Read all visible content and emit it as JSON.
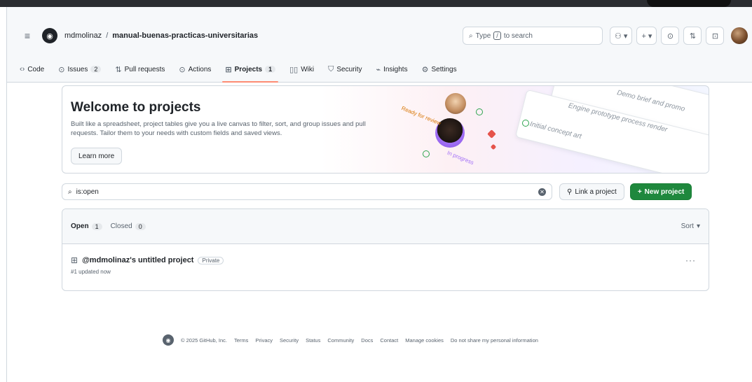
{
  "header": {
    "owner": "mdmolinaz",
    "separator": "/",
    "repo": "manual-buenas-practicas-universitarias",
    "search": {
      "prefix": "Type",
      "key": "/",
      "suffix": "to search"
    },
    "tools": {
      "copilot": "⚇ ▾",
      "create": "+ ▾",
      "issues": "⊙",
      "pulls": "⇅",
      "inbox": "⊡"
    }
  },
  "nav": {
    "items": [
      {
        "label": "Code",
        "icon": "code-icon",
        "glyph": "‹›"
      },
      {
        "label": "Issues",
        "icon": "issue-icon",
        "glyph": "⊙",
        "count": "2"
      },
      {
        "label": "Pull requests",
        "icon": "pull-request-icon",
        "glyph": "⇅"
      },
      {
        "label": "Actions",
        "icon": "play-icon",
        "glyph": "⊙"
      },
      {
        "label": "Projects",
        "icon": "table-icon",
        "glyph": "⊞",
        "count": "1",
        "selected": true
      },
      {
        "label": "Wiki",
        "icon": "book-icon",
        "glyph": "▯▯"
      },
      {
        "label": "Security",
        "icon": "shield-icon",
        "glyph": "⛉"
      },
      {
        "label": "Insights",
        "icon": "graph-icon",
        "glyph": "⌁"
      },
      {
        "label": "Settings",
        "icon": "gear-icon",
        "glyph": "⚙"
      }
    ]
  },
  "banner": {
    "title": "Welcome to projects",
    "description": "Built like a spreadsheet, project tables give you a live canvas to filter, sort, and group issues and pull requests. Tailor them to your needs with custom fields and saved views.",
    "learn_more": "Learn more",
    "deco": {
      "line1": "Demo brief and promo",
      "line2": "Engine prototype process render",
      "line3": "Initial concept art",
      "tag1": "Ready for review",
      "tag2": "In progress"
    }
  },
  "filter": {
    "value": "is:open",
    "link_project": "Link a project",
    "new_project": "New project"
  },
  "list": {
    "open_label": "Open",
    "open_count": "1",
    "closed_label": "Closed",
    "closed_count": "0",
    "sort_label": "Sort",
    "projects": [
      {
        "title": "@mdmolinaz's untitled project",
        "badge": "Private",
        "meta": "#1 updated now"
      }
    ]
  },
  "footer": {
    "copyright": "© 2025 GitHub, Inc.",
    "links": [
      "Terms",
      "Privacy",
      "Security",
      "Status",
      "Community",
      "Docs",
      "Contact",
      "Manage cookies",
      "Do not share my personal information"
    ]
  },
  "colors": {
    "accent": "#fd8c73",
    "primary_button": "#1f883d",
    "border": "#d0d7de"
  }
}
